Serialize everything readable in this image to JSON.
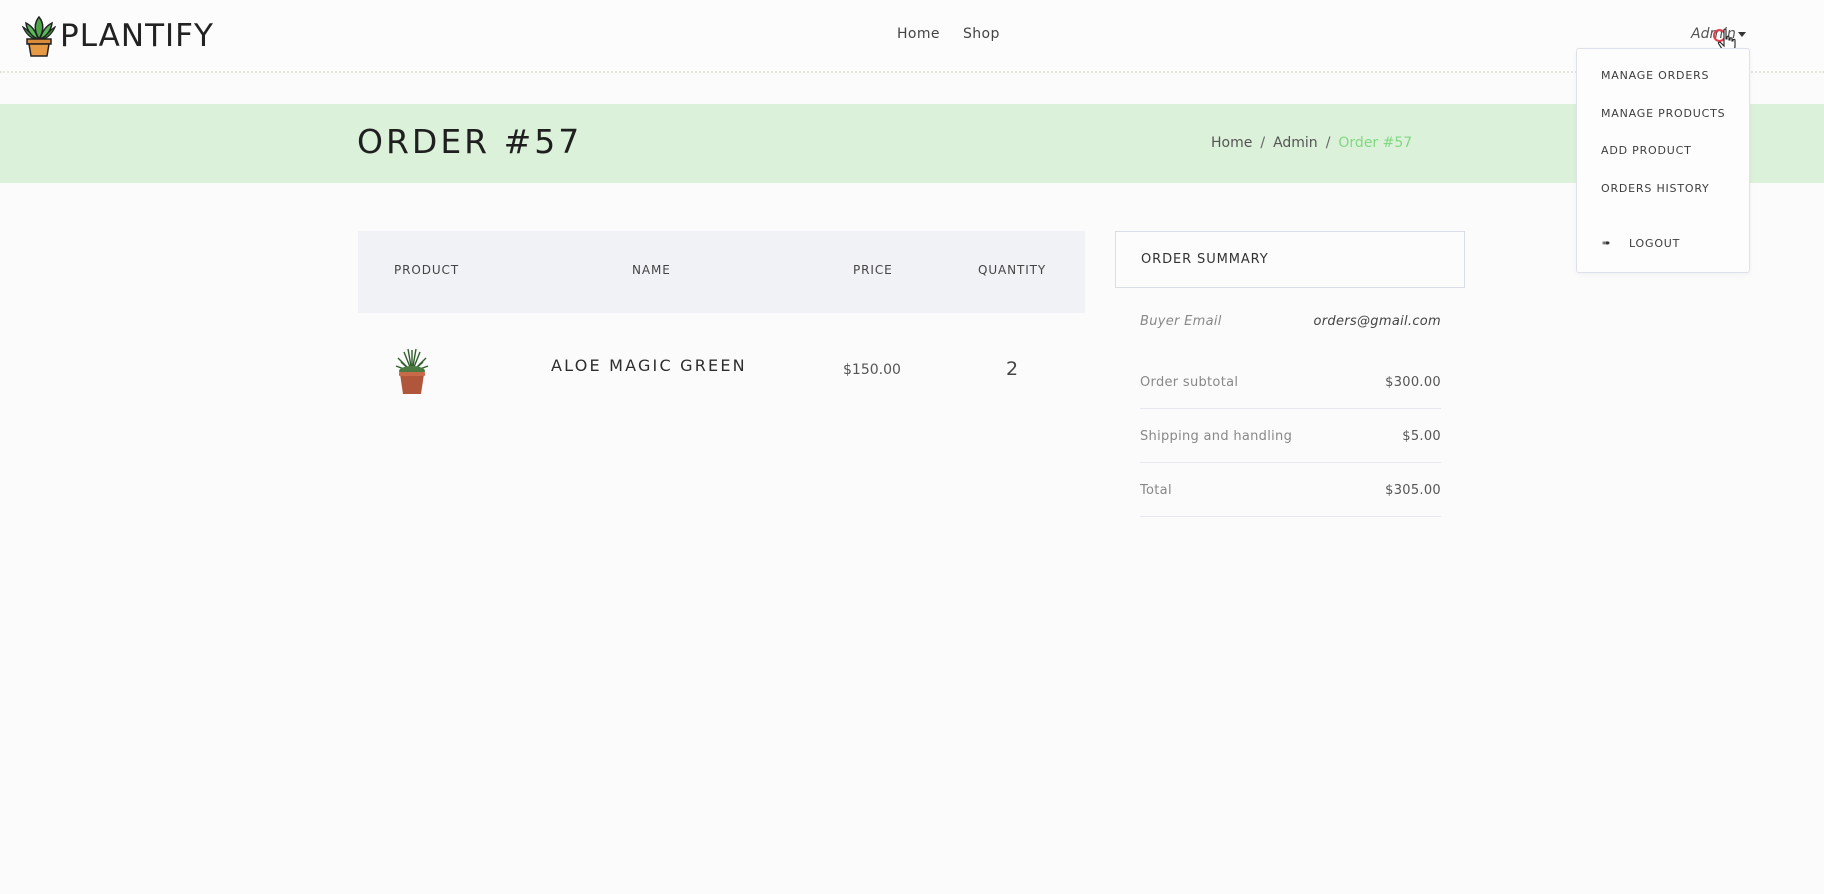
{
  "brand": {
    "name": "PLANTIFY"
  },
  "nav": {
    "home": "Home",
    "shop": "Shop",
    "admin": "Admin"
  },
  "dropdown": {
    "items": [
      "MANAGE ORDERS",
      "MANAGE PRODUCTS",
      "ADD PRODUCT",
      "ORDERS HISTORY"
    ],
    "logout": "LOGOUT"
  },
  "banner": {
    "title": "ORDER #57",
    "breadcrumb": [
      "Home",
      "Admin",
      "Order #57"
    ]
  },
  "table": {
    "headers": [
      "PRODUCT",
      "NAME",
      "PRICE",
      "QUANTITY"
    ],
    "rows": [
      {
        "name": "ALOE MAGIC GREEN",
        "price": "$150.00",
        "quantity": "2"
      }
    ]
  },
  "summary": {
    "title": "ORDER SUMMARY",
    "buyer_email_label": "Buyer Email",
    "buyer_email": "orders@gmail.com",
    "subtotal_label": "Order subtotal",
    "subtotal": "$300.00",
    "shipping_label": "Shipping and handling",
    "shipping": "$5.00",
    "total_label": "Total",
    "total": "$305.00"
  },
  "colors": {
    "banner_bg": "#dbf1d9",
    "breadcrumb_active": "#82d882",
    "cursor_ring": "#e0414f"
  },
  "icons": {
    "logo": "plant-pot-icon",
    "logout": "sign-out-icon",
    "caret": "caret-down-icon",
    "cursor": "hand-pointer-cursor"
  }
}
